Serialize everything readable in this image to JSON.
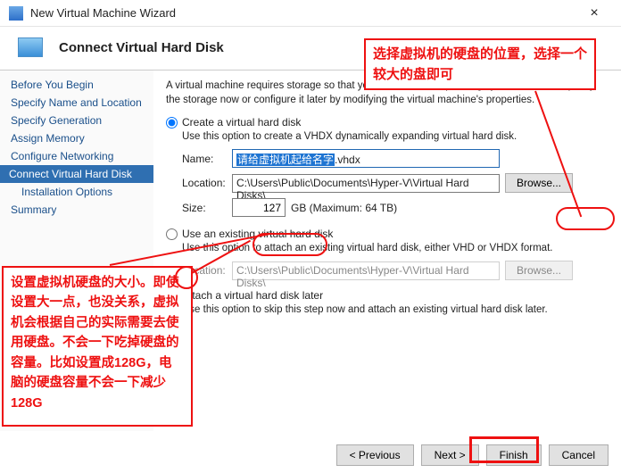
{
  "window": {
    "title": "New Virtual Machine Wizard"
  },
  "header": {
    "title": "Connect Virtual Hard Disk"
  },
  "sidebar": {
    "items": [
      {
        "label": "Before You Begin"
      },
      {
        "label": "Specify Name and Location"
      },
      {
        "label": "Specify Generation"
      },
      {
        "label": "Assign Memory"
      },
      {
        "label": "Configure Networking"
      },
      {
        "label": "Connect Virtual Hard Disk"
      },
      {
        "label": "Installation Options"
      },
      {
        "label": "Summary"
      }
    ]
  },
  "content": {
    "intro": "A virtual machine requires storage so that you can install an operating system. You can specify the storage now or configure it later by modifying the virtual machine's properties.",
    "opt1": {
      "label": "Create a virtual hard disk",
      "desc": "Use this option to create a VHDX dynamically expanding virtual hard disk.",
      "name_label": "Name:",
      "name_sel": "请给虚拟机起给名字",
      "name_ext": ".vhdx",
      "loc_label": "Location:",
      "loc_value": "C:\\Users\\Public\\Documents\\Hyper-V\\Virtual Hard Disks\\",
      "browse": "Browse...",
      "size_label": "Size:",
      "size_value": "127",
      "size_unit": "GB (Maximum: 64 TB)"
    },
    "opt2": {
      "label": "Use an existing virtual hard disk",
      "desc": "Use this option to attach an existing virtual hard disk, either VHD or VHDX format.",
      "loc_label": "Location:",
      "loc_value": "C:\\Users\\Public\\Documents\\Hyper-V\\Virtual Hard Disks\\",
      "browse": "Browse..."
    },
    "opt3": {
      "label": "Attach a virtual hard disk later",
      "desc": "Use this option to skip this step now and attach an existing virtual hard disk later."
    }
  },
  "footer": {
    "previous": "< Previous",
    "next": "Next >",
    "finish": "Finish",
    "cancel": "Cancel"
  },
  "annotations": {
    "box1": "选择虚拟机的硬盘的位置，选择一个较大的盘即可",
    "box2": "设置虚拟机硬盘的大小。即使设置大一点，也没关系，虚拟机会根据自己的实际需要去使用硬盘。不会一下吃掉硬盘的容量。比如设置成128G，电脑的硬盘容量不会一下减少128G"
  }
}
